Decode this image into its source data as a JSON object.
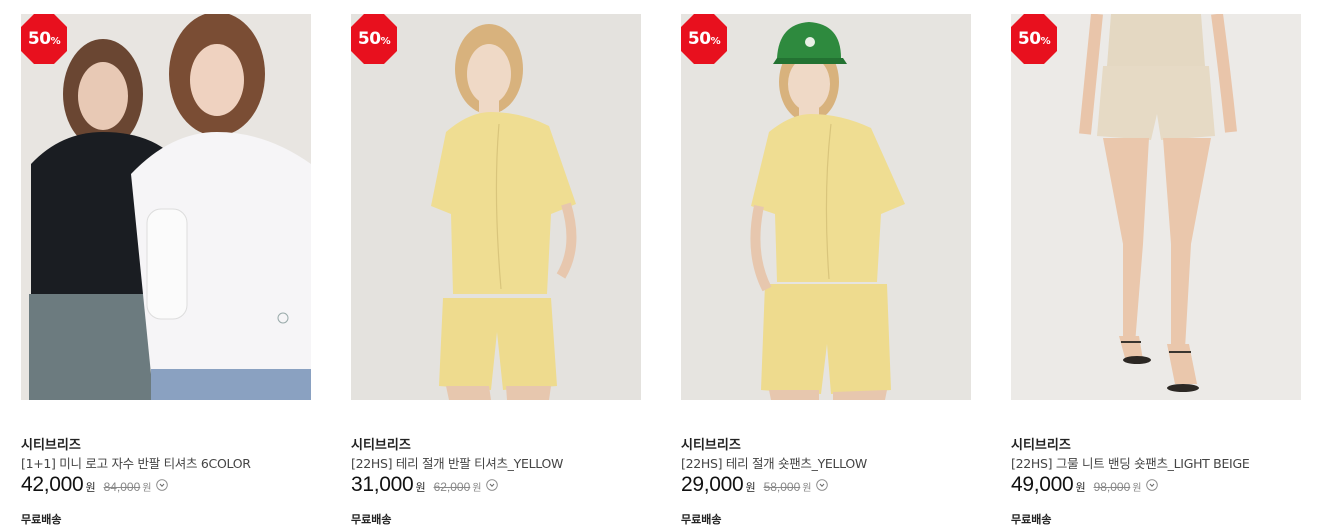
{
  "products": [
    {
      "discount": "50",
      "percent": "%",
      "brand": "시티브리즈",
      "name": "[1+1] 미니 로고 자수 반팔 티셔츠 6COLOR",
      "price": "42,000",
      "currency": "원",
      "original_price": "84,000",
      "original_currency": "원",
      "shipping": "무료배송",
      "image_icon": "product-photo"
    },
    {
      "discount": "50",
      "percent": "%",
      "brand": "시티브리즈",
      "name": "[22HS] 테리 절개 반팔 티셔츠_YELLOW",
      "price": "31,000",
      "currency": "원",
      "original_price": "62,000",
      "original_currency": "원",
      "shipping": "무료배송",
      "image_icon": "product-photo"
    },
    {
      "discount": "50",
      "percent": "%",
      "brand": "시티브리즈",
      "name": "[22HS] 테리 절개 숏팬츠_YELLOW",
      "price": "29,000",
      "currency": "원",
      "original_price": "58,000",
      "original_currency": "원",
      "shipping": "무료배송",
      "image_icon": "product-photo"
    },
    {
      "discount": "50",
      "percent": "%",
      "brand": "시티브리즈",
      "name": "[22HS] 그물 니트 밴딩 숏팬츠_LIGHT BEIGE",
      "price": "49,000",
      "currency": "원",
      "original_price": "98,000",
      "original_currency": "원",
      "shipping": "무료배송",
      "image_icon": "product-photo"
    }
  ],
  "colors": {
    "badge": "#e8101e",
    "yellow": "#eedd8c",
    "green_cap": "#2e8a3e",
    "beige": "#e4d8c2"
  }
}
